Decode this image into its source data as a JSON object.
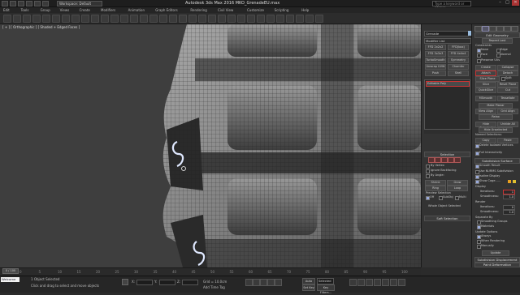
{
  "titlebar": {
    "workspace": "Workspace: Default",
    "app_title": "Autodesk 3ds Max 2016     MKO_GrenadeEU.max",
    "search_placeholder": "Type a keyword or phrase",
    "minimize": "–",
    "maximize": "□",
    "close": "✕"
  },
  "menu": [
    "Edit",
    "Tools",
    "Group",
    "Views",
    "Create",
    "Modifiers",
    "Animation",
    "Graph Editors",
    "Rendering",
    "Civil View",
    "Customize",
    "Scripting",
    "Help"
  ],
  "viewport": {
    "label": "[ + ] [ Orthographic ] [ Shaded + Edged Faces ]"
  },
  "scene_panel": {
    "name_field": "Grenade",
    "modifier_list": "Modifier List",
    "buttons": [
      "FFD 2x2x2",
      "FFD(box)",
      "FFD 3x3x3",
      "FFD 4x4x4",
      "TurboSmooth",
      "Symmetry",
      "Unwrap UVW",
      "Chamfer",
      "Push",
      "Shell"
    ],
    "stack_item": "Editable Poly",
    "selection_title": "Selection",
    "by_vertex": "By Vertex",
    "ignore_backfacing": "Ignore Backfacing",
    "by_angle": "By Angle:",
    "shrink": "Shrink",
    "grow": "Grow",
    "ring": "Ring",
    "loop": "Loop",
    "preview_selection": "Preview Selection",
    "off": "Off",
    "subobj": "SubObj",
    "multi": "Multi",
    "whole_object": "Whole Object Selected",
    "soft_selection": "Soft Selection"
  },
  "command_panel": {
    "edit_geometry": "Edit Geometry",
    "repeat_last": "Repeat Last",
    "constraints": "Constraints",
    "none": "None",
    "edge": "Edge",
    "face": "Face",
    "normal": "Normal",
    "preserve_uvs": "Preserve UVs",
    "create": "Create",
    "collapse": "Collapse",
    "attach": "Attach",
    "detach": "Detach",
    "slice_plane": "Slice Plane",
    "split": "Split",
    "slice": "Slice",
    "reset_plane": "Reset Plane",
    "quickslice": "QuickSlice",
    "cut": "Cut",
    "msmooth": "MSmooth",
    "tessellate": "Tessellate",
    "make_planar": "Make Planar",
    "view_align": "View Align",
    "grid_align": "Grid Align",
    "relax": "Relax",
    "hide_selected": "Hide Selected",
    "unhide_all": "Unhide All",
    "hide_unselected": "Hide Unselected",
    "named_selections": "Named Selections:",
    "copy": "Copy",
    "paste": "Paste",
    "delete_isolated": "Delete Isolated Vertices",
    "full_interactivity": "Full Interactivity",
    "subdivision_surface": "Subdivision Surface",
    "smooth_result": "Smooth Result",
    "use_nurms": "Use NURMS Subdivision",
    "isoline_display": "Isoline Display",
    "show_cage": "Show Cage......",
    "display": "Display",
    "iterations_label": "Iterations:",
    "iterations_value": "1",
    "smoothness_label": "Smoothness:",
    "smoothness_value": "1.0",
    "render": "Render",
    "render_iterations": "0",
    "render_smoothness": "1.0",
    "separate_by": "Separate By",
    "smoothing_groups": "Smoothing Groups",
    "materials": "Materials",
    "update_options": "Update Options",
    "always": "Always",
    "when_rendering": "When Rendering",
    "manually": "Manually",
    "update": "Update",
    "subdivision_displacement": "Subdivision Displacement",
    "paint_deformation": "Paint Deformation"
  },
  "timeline": {
    "frame": "0 / 100",
    "ticks": [
      "0",
      "5",
      "10",
      "15",
      "20",
      "25",
      "30",
      "35",
      "40",
      "45",
      "50",
      "55",
      "60",
      "65",
      "70",
      "75",
      "80",
      "85",
      "90",
      "95",
      "100"
    ]
  },
  "status": {
    "maxscript": "Welcome to MAX",
    "selected": "1 Object Selected",
    "hint": "Click and drag to select and move objects",
    "grid": "Grid = 10.0cm",
    "add_time_tag": "Add Time Tag",
    "auto_key": "Auto Key",
    "selected_mode": "Selected",
    "set_key": "Set Key",
    "key_filters": "Key Filters..."
  }
}
